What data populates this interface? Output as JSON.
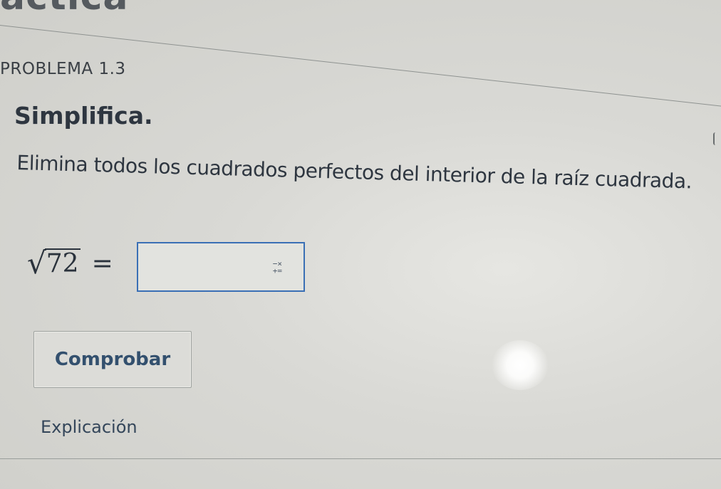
{
  "header": {
    "title_fragment": "áctica"
  },
  "problem": {
    "label": "PROBLEMA 1.3",
    "instruction": "Simplifica.",
    "description": "Elimina todos los cuadrados perfectos del interior de la raíz cuadrada."
  },
  "expression": {
    "radical_symbol": "√",
    "radicand": "72",
    "equals": "="
  },
  "answer": {
    "value": "",
    "math_keys_icon": "math-keypad-icon",
    "math_keys_top": "−×",
    "math_keys_bottom": "+="
  },
  "actions": {
    "check_label": "Comprobar",
    "explanation_label": "Explicación"
  },
  "colors": {
    "input_border": "#3a6fb5",
    "button_text": "#33506e"
  }
}
